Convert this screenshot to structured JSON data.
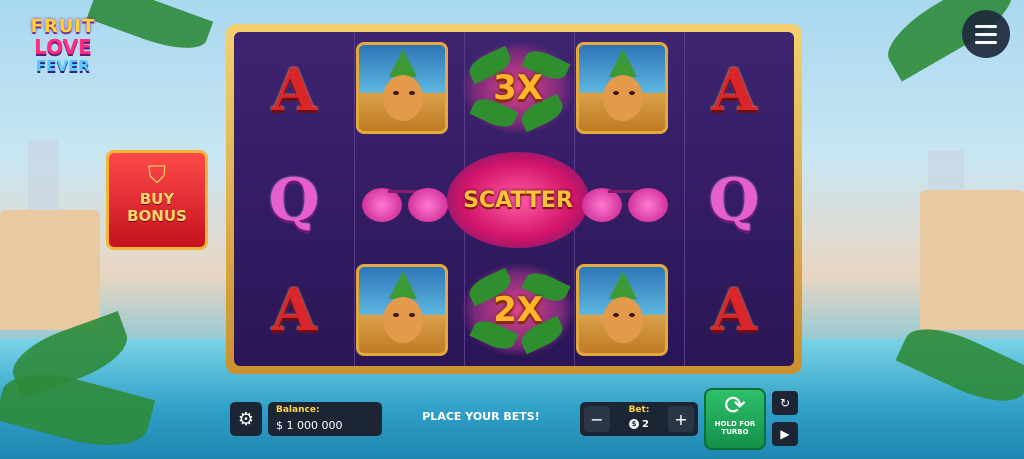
{
  "game": {
    "logo": {
      "line1": "FRUIT",
      "line2": "LOVE",
      "line3": "FEVER"
    }
  },
  "buy_bonus": {
    "line1": "BUY",
    "line2": "BONUS"
  },
  "reels": {
    "letters": {
      "a": "A",
      "q": "Q"
    },
    "multipliers": {
      "top": "3X",
      "bottom": "2X"
    },
    "scatter": "SCATTER"
  },
  "controls": {
    "balance_label": "Balance:",
    "balance_value": "$ 1 000 000",
    "status": "PLACE YOUR BETS!",
    "bet_label": "Bet:",
    "bet_coin": "$",
    "bet_value": "2",
    "minus": "−",
    "plus": "+",
    "spin_label_1": "HOLD FOR",
    "spin_label_2": "TURBO"
  },
  "icons": [
    "menu-icon",
    "basket-icon",
    "settings-icon",
    "spin-icon",
    "autoplay-icon",
    "play-icon"
  ],
  "colors": {
    "frame": "#e3b04b",
    "reels_bg": "#2f1a60",
    "spin": "#22a85a",
    "accent": "#ffd34a"
  }
}
